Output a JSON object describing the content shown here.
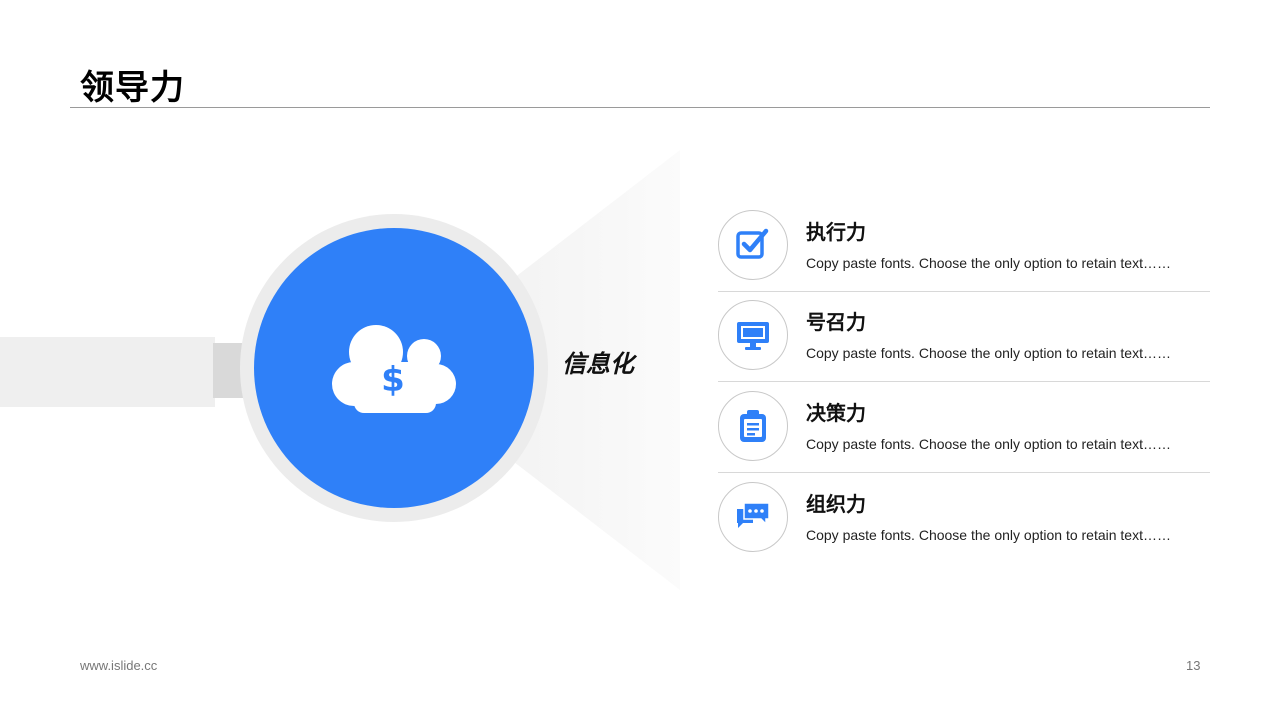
{
  "title": "领导力",
  "beam_label": "信息化",
  "colors": {
    "accent": "#2f80f8",
    "ring": "#ececec",
    "divider": "#d8d8d8"
  },
  "center_icon": "cloud-dollar-icon",
  "items": [
    {
      "title": "执行力",
      "desc": "Copy paste fonts. Choose the only option to retain text……",
      "icon": "checkbox-icon"
    },
    {
      "title": "号召力",
      "desc": "Copy paste fonts. Choose the only option to retain text……",
      "icon": "monitor-icon"
    },
    {
      "title": "决策力",
      "desc": "Copy paste fonts. Choose the only option to retain text……",
      "icon": "clipboard-icon"
    },
    {
      "title": "组织力",
      "desc": "Copy paste fonts. Choose the only option to retain text……",
      "icon": "chat-icon"
    }
  ],
  "footer": {
    "url": "www.islide.cc",
    "page": "13"
  }
}
